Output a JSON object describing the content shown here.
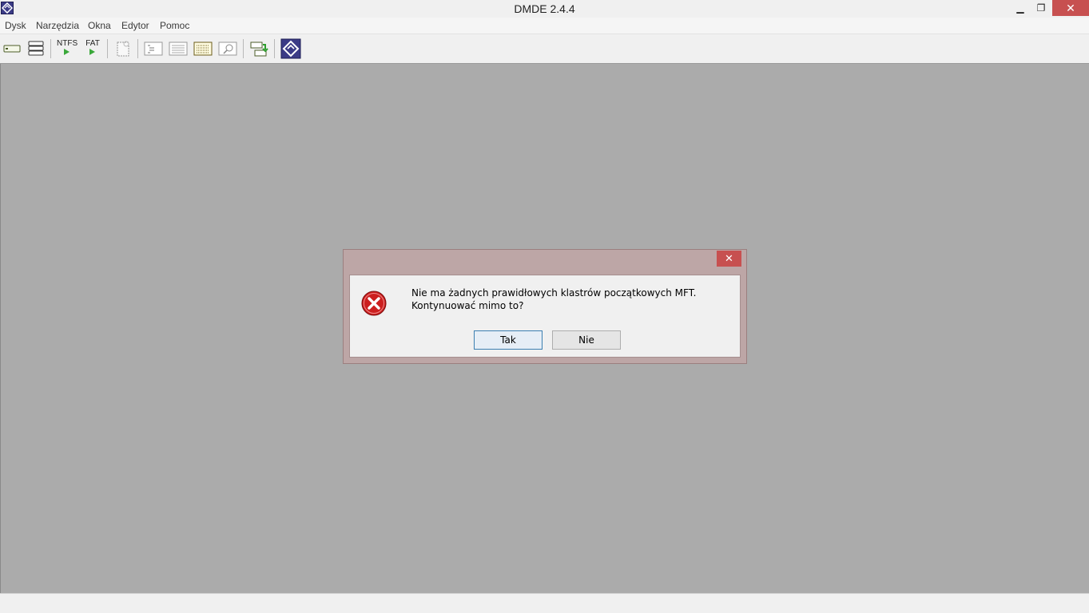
{
  "window": {
    "title": "DMDE 2.4.4",
    "minimize_glyph": "▁",
    "restore_glyph": "❐",
    "close_glyph": "✕"
  },
  "menu": {
    "items": [
      "Dysk",
      "Narzędzia",
      "Okna",
      "Edytor",
      "Pomoc"
    ]
  },
  "toolbar": {
    "buttons": [
      {
        "icon": "physical-disk-icon"
      },
      {
        "icon": "logical-disk-icon"
      },
      {
        "icon": "ntfs-search-icon",
        "label": "NTFS"
      },
      {
        "icon": "fat-search-icon",
        "label": "FAT"
      },
      {
        "icon": "file-open-icon"
      },
      {
        "icon": "tree-view-icon"
      },
      {
        "icon": "list-view-icon"
      },
      {
        "icon": "hex-view-icon"
      },
      {
        "icon": "find-icon"
      },
      {
        "icon": "copy-sectors-icon"
      },
      {
        "icon": "dmde-logo-icon"
      }
    ]
  },
  "dialog": {
    "close_glyph": "✕",
    "icon": "error-icon",
    "message_line1": "Nie ma żadnych prawidłowych klastrów początkowych MFT.",
    "message_line2": "Kontynuować mimo to?",
    "yes_label": "Tak",
    "no_label": "Nie"
  },
  "colors": {
    "workspace": "#ababab",
    "close_red": "#c75050",
    "dialog_frame": "#bda6a6",
    "error_red": "#cc1f1f"
  }
}
